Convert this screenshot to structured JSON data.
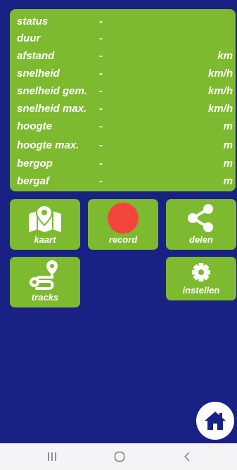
{
  "stats": [
    {
      "label": "status",
      "value": "-",
      "unit": ""
    },
    {
      "label": "duur",
      "value": "-",
      "unit": ""
    },
    {
      "label": "afstand",
      "value": "-",
      "unit": "km"
    },
    {
      "label": "snelheid",
      "value": "-",
      "unit": "km/h"
    },
    {
      "label": "snelheid gem.",
      "value": "-",
      "unit": "km/h"
    },
    {
      "label": "snelheid max.",
      "value": "-",
      "unit": "km/h"
    },
    {
      "label": "hoogte",
      "value": "-",
      "unit": "m"
    },
    {
      "label": "hoogte max.",
      "value": "-",
      "unit": "m"
    },
    {
      "label": "bergop",
      "value": "-",
      "unit": "m"
    },
    {
      "label": "bergaf",
      "value": "-",
      "unit": "m"
    }
  ],
  "tiles": {
    "kaart": {
      "label": "kaart",
      "icon": "map-pin-icon"
    },
    "record": {
      "label": "record",
      "icon": "record-dot-icon"
    },
    "delen": {
      "label": "delen",
      "icon": "share-icon"
    },
    "tracks": {
      "label": "tracks",
      "icon": "route-icon"
    },
    "instellen": {
      "label": "instellen",
      "icon": "gear-icon"
    }
  },
  "home": {
    "icon": "home-icon"
  },
  "navbar": {
    "icons": [
      "recent-apps-icon",
      "home-circle-icon",
      "back-icon"
    ]
  },
  "colors": {
    "background": "#1a2184",
    "panel": "#7dba2f",
    "record": "#f2453d",
    "text": "#ffffff"
  }
}
